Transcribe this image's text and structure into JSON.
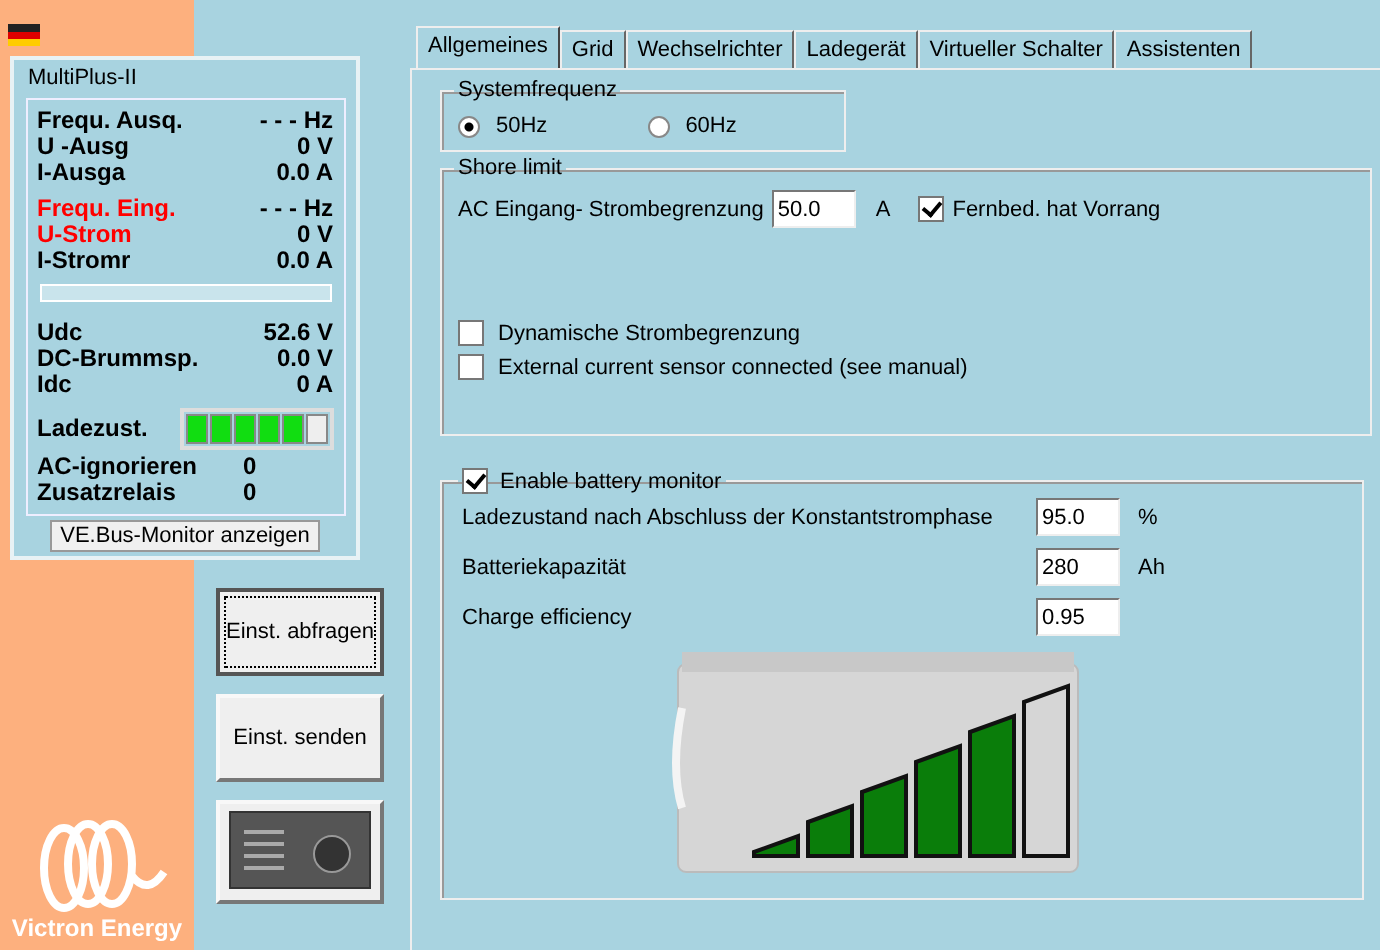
{
  "device": {
    "title": "MultiPlus-II",
    "groups": [
      [
        {
          "label": "Frequ. Ausq.",
          "value": "- - - Hz",
          "alert": false
        },
        {
          "label": "U -Ausg",
          "value": "0 V",
          "alert": false
        },
        {
          "label": "I-Ausga",
          "value": "0.0 A",
          "alert": false
        }
      ],
      [
        {
          "label": "Frequ. Eing.",
          "value": "- - - Hz",
          "alert": true
        },
        {
          "label": "U-Strom",
          "value": "0 V",
          "alert": true
        },
        {
          "label": "I-Stromr",
          "value": "0.0 A",
          "alert": false
        }
      ],
      [
        {
          "label": "Udc",
          "value": "52.6 V",
          "alert": false
        },
        {
          "label": "DC-Brummsp.",
          "value": "0.0 V",
          "alert": false
        },
        {
          "label": "Idc",
          "value": "0 A",
          "alert": false
        }
      ]
    ],
    "charge": {
      "label": "Ladezust.",
      "level": 0.83
    },
    "extras": [
      {
        "label": "AC-ignorieren",
        "value": "0"
      },
      {
        "label": "Zusatzrelais",
        "value": "0"
      }
    ],
    "monitor_button": "VE.Bus-Monitor anzeigen"
  },
  "logo": "Victron Energy",
  "buttons": [
    {
      "label": "Einst. abfragen",
      "focused": true
    },
    {
      "label": "Einst. senden",
      "focused": false
    }
  ],
  "tabs": [
    {
      "label": "Allgemeines",
      "selected": true
    },
    {
      "label": "Grid",
      "selected": false
    },
    {
      "label": "Wechselrichter",
      "selected": false
    },
    {
      "label": "Ladegerät",
      "selected": false
    },
    {
      "label": "Virtueller Schalter",
      "selected": false
    },
    {
      "label": "Assistenten",
      "selected": false
    }
  ],
  "system_frequency": {
    "title": "Systemfrequenz",
    "options": [
      {
        "label": "50Hz",
        "selected": true
      },
      {
        "label": "60Hz",
        "selected": false
      }
    ]
  },
  "shore_limit": {
    "title": "Shore limit",
    "field_label": "AC Eingang- Strombegrenzung",
    "value": "50.0",
    "unit": "A",
    "remote": {
      "label": "Fernbed. hat Vorrang",
      "checked": true
    },
    "options": [
      {
        "label": "Dynamische Strombegrenzung",
        "checked": false
      },
      {
        "label": "External current sensor connected (see manual)",
        "checked": false
      }
    ]
  },
  "battery_monitor": {
    "title": "Enable battery monitor",
    "checked": true,
    "fields": [
      {
        "label": "Ladezustand nach Abschluss der Konstantstromphase",
        "value": "95.0",
        "unit": "%"
      },
      {
        "label": "Batteriekapazität",
        "value": "280",
        "unit": "Ah"
      },
      {
        "label": "Charge efficiency",
        "value": "0.95"
      }
    ],
    "bars": [
      {
        "filled": true
      },
      {
        "filled": true
      },
      {
        "filled": true
      },
      {
        "filled": true
      },
      {
        "filled": true
      },
      {
        "filled": false
      }
    ]
  }
}
